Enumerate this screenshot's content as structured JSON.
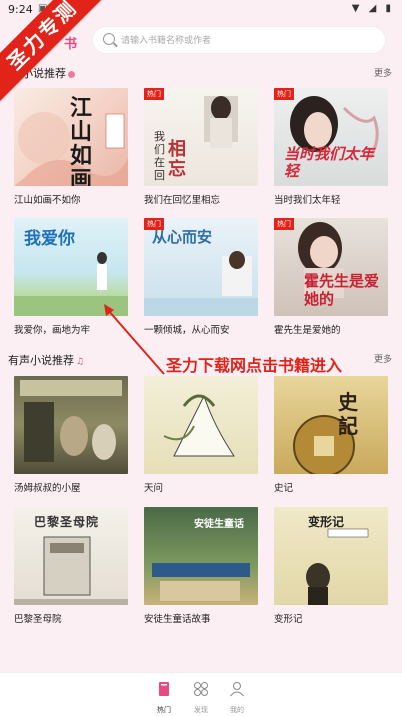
{
  "status_bar": {
    "time": "9:24"
  },
  "banner": {
    "text": "圣力专测"
  },
  "header": {
    "tab_label": "书"
  },
  "search": {
    "placeholder": "请输入书籍名称或作者"
  },
  "sections": {
    "novels": {
      "title": "小说推荐",
      "more": "更多"
    },
    "audio": {
      "title": "有声小说推荐",
      "more": "更多"
    }
  },
  "badge": {
    "hot": "热门"
  },
  "novels": [
    {
      "title": "江山如画不如你",
      "cover_text": "江山如画"
    },
    {
      "title": "我们在回忆里相忘",
      "cover_text": "相忘"
    },
    {
      "title": "当时我们太年轻",
      "cover_text": "当时我们太年轻"
    },
    {
      "title": "我爱你，画地为牢",
      "cover_text": "我爱你"
    },
    {
      "title": "一颗倾城，从心而安",
      "cover_text": "从心而安"
    },
    {
      "title": "霍先生是爱她的",
      "cover_text": "霍先生是爱她的"
    }
  ],
  "audio_books": [
    {
      "title": "汤姆叔叔的小屋",
      "cover_text": ""
    },
    {
      "title": "天问",
      "cover_text": ""
    },
    {
      "title": "史记",
      "cover_text": "史記"
    },
    {
      "title": "巴黎圣母院",
      "cover_text": "巴黎圣母院"
    },
    {
      "title": "安徒生童话故事",
      "cover_text": "安徒生童话"
    },
    {
      "title": "变形记",
      "cover_text": "变形记"
    }
  ],
  "annotation": {
    "text": "圣力下载网点击书籍进入"
  },
  "bottom_nav": [
    {
      "label": "热门",
      "icon": "book-icon"
    },
    {
      "label": "发现",
      "icon": "grid-icon"
    },
    {
      "label": "我的",
      "icon": "person-icon"
    }
  ]
}
